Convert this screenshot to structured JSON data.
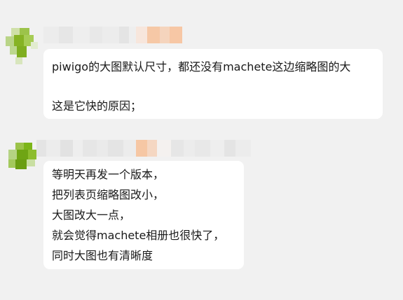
{
  "messages": [
    {
      "lines": [
        "piwigo的大图默认尺寸，都还没有machete这边缩略图的大",
        "",
        "这是它快的原因；"
      ]
    },
    {
      "lines": [
        "等明天再发一个版本，",
        "把列表页缩略图改小，",
        "大图改大一点，",
        "就会觉得machete相册也很快了，",
        "同时大图也有清晰度"
      ]
    }
  ],
  "colors": {
    "background": "#f1f1f1",
    "bubble": "#ffffff",
    "text": "#191919",
    "avatar_green": "#7cb518"
  }
}
